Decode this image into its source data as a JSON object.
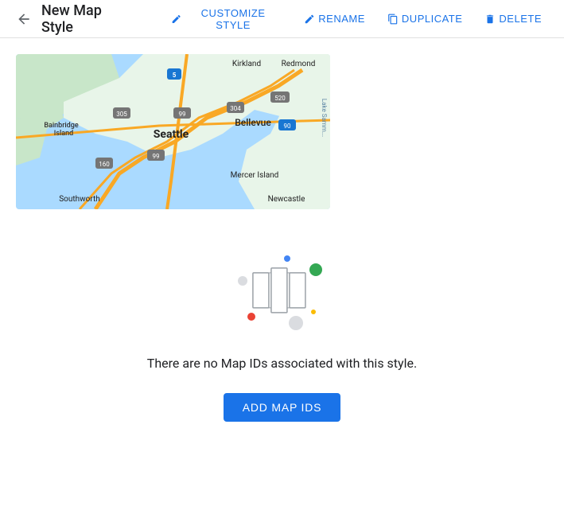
{
  "header": {
    "title": "New Map Style",
    "back_label": "Back",
    "actions": [
      {
        "id": "customize",
        "label": "CUSTOMIZE STYLE",
        "icon": "✏️"
      },
      {
        "id": "rename",
        "label": "RENAME",
        "icon": "✏️"
      },
      {
        "id": "duplicate",
        "label": "DUPLICATE",
        "icon": "⧉"
      },
      {
        "id": "delete",
        "label": "DELETE",
        "icon": "🗑"
      }
    ]
  },
  "empty_state": {
    "message": "There are no Map IDs associated with this style.",
    "add_button_label": "ADD MAP IDS"
  }
}
